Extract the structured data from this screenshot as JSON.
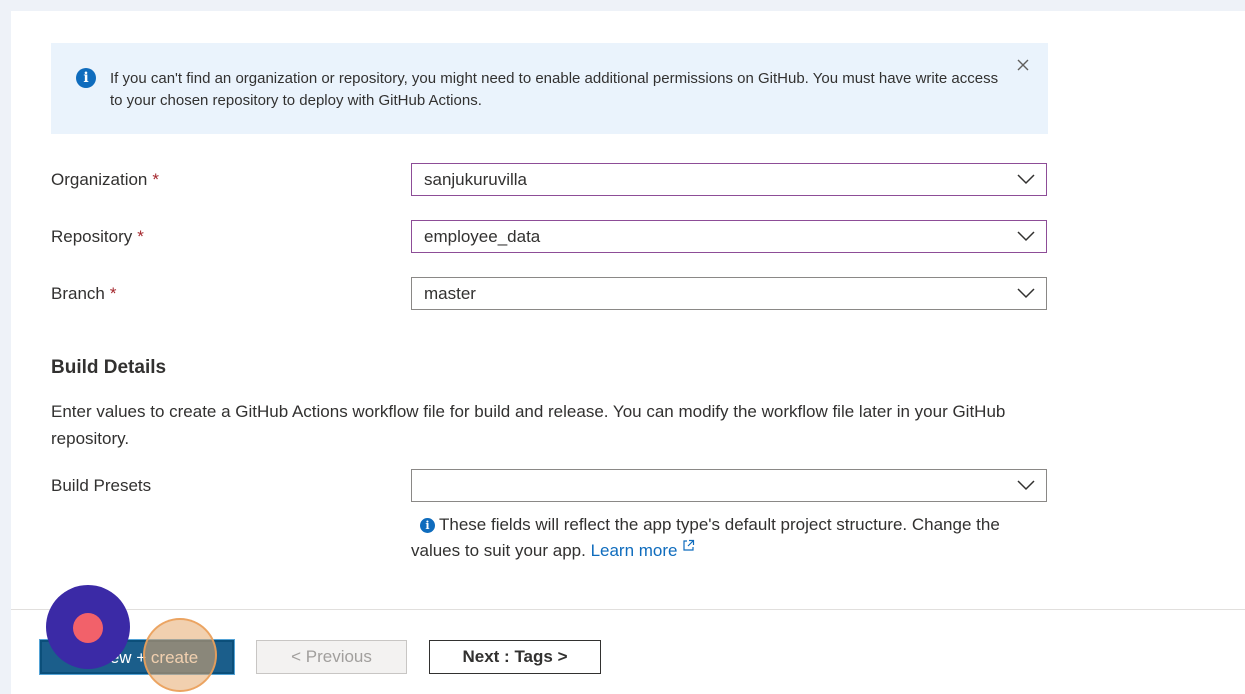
{
  "notice": {
    "text": "If you can't find an organization or repository, you might need to enable additional permissions on GitHub. You must have write access to your chosen repository to deploy with GitHub Actions.",
    "close_glyph": "×"
  },
  "fields": {
    "organization": {
      "label": "Organization",
      "required_mark": "*",
      "value": "sanjukuruvilla"
    },
    "repository": {
      "label": "Repository",
      "required_mark": "*",
      "value": "employee_data"
    },
    "branch": {
      "label": "Branch",
      "required_mark": "*",
      "value": "master"
    }
  },
  "build_details": {
    "title": "Build Details",
    "description": "Enter values to create a GitHub Actions workflow file for build and release. You can modify the workflow file later in your GitHub repository.",
    "presets": {
      "label": "Build Presets",
      "value": ""
    },
    "hint": {
      "text": "These fields will reflect the app type's default project structure. Change the values to suit your app.",
      "link": "Learn more"
    }
  },
  "footer": {
    "primary_label": "Review + create",
    "previous_label": "< Previous",
    "next_label": "Next : Tags >"
  },
  "colors": {
    "accent": "#0f6cbd",
    "focus_border": "#8d4d97",
    "required": "#a4262c",
    "primary_button": "#1b5e8b",
    "recorder": "#3b2aa6",
    "recorder_dot": "#f2616a"
  }
}
